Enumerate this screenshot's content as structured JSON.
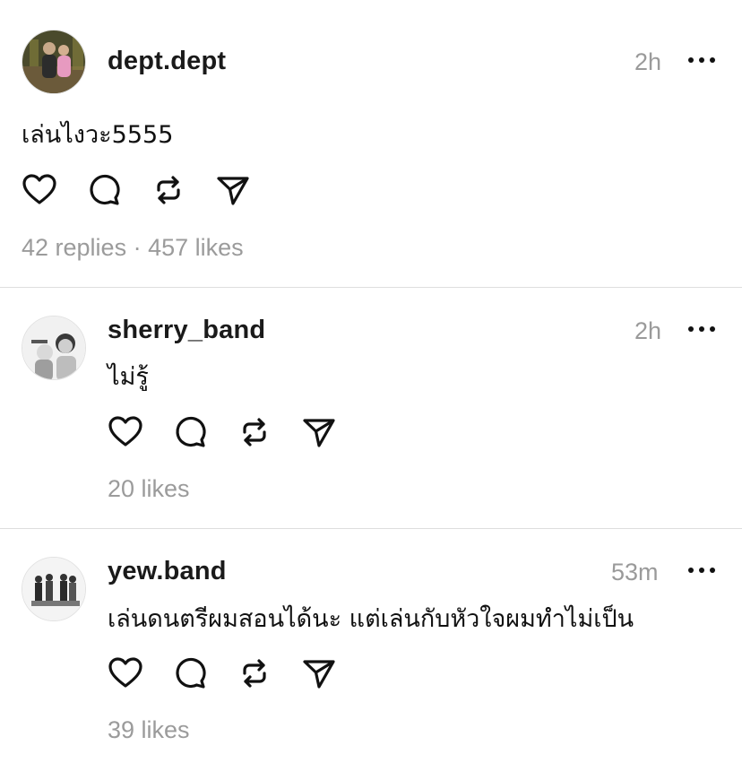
{
  "posts": [
    {
      "username": "dept.dept",
      "time": "2h",
      "text": "เล่นไงวะ5555",
      "replies": "42 replies",
      "separator": "·",
      "likes": "457 likes"
    },
    {
      "username": "sherry_band",
      "time": "2h",
      "text": "ไม่รู้",
      "likes": "20 likes"
    },
    {
      "username": "yew.band",
      "time": "53m",
      "text": "เล่นดนตรีผมสอนได้นะ แต่เล่นกับหัวใจผมทำไม่เป็น",
      "likes": "39 likes"
    }
  ],
  "icons": {
    "like": "heart-icon",
    "reply": "comment-icon",
    "repost": "repost-icon",
    "share": "send-icon",
    "more": "more-icon"
  }
}
